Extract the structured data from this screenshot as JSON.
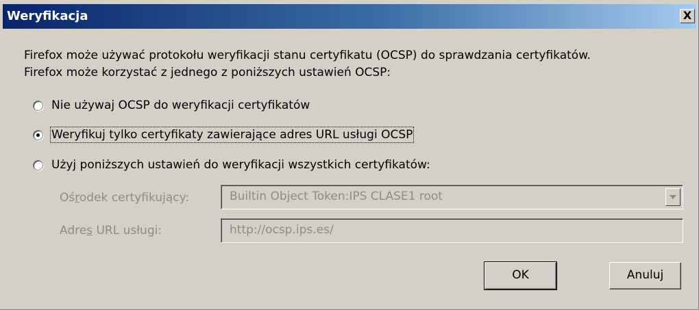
{
  "window": {
    "title": "Weryfikacja",
    "close_label": "X"
  },
  "description": {
    "line1": "Firefox może używać protokołu weryfikacji stanu certyfikatu (OCSP) do sprawdzania certyfikatów.",
    "line2": "Firefox może korzystać z jednego z poniższych ustawień OCSP:"
  },
  "options": [
    {
      "label": "Nie używaj OCSP do weryfikacji certyfikatów",
      "checked": false
    },
    {
      "label": "Weryfikuj tylko certyfikaty zawierające adres URL usługi OCSP",
      "checked": true
    },
    {
      "label": "Użyj poniższych ustawień do weryfikacji wszystkich certyfikatów:",
      "checked": false
    }
  ],
  "fields": {
    "authority_label_pre": "Oś",
    "authority_label_u": "r",
    "authority_label_post": "odek certyfikujący:",
    "authority_value": "Builtin Object Token:IPS CLASE1 root",
    "url_label_pre": "Adre",
    "url_label_u": "s",
    "url_label_post": " URL usługi:",
    "url_value": "http://ocsp.ips.es/"
  },
  "buttons": {
    "ok": "OK",
    "cancel": "Anuluj"
  },
  "colors": {
    "title_gradient_start": "#0a246a",
    "title_gradient_end": "#a6caf0",
    "dialog_bg": "#d4d0c8",
    "disabled_text": "#8e8b84"
  }
}
